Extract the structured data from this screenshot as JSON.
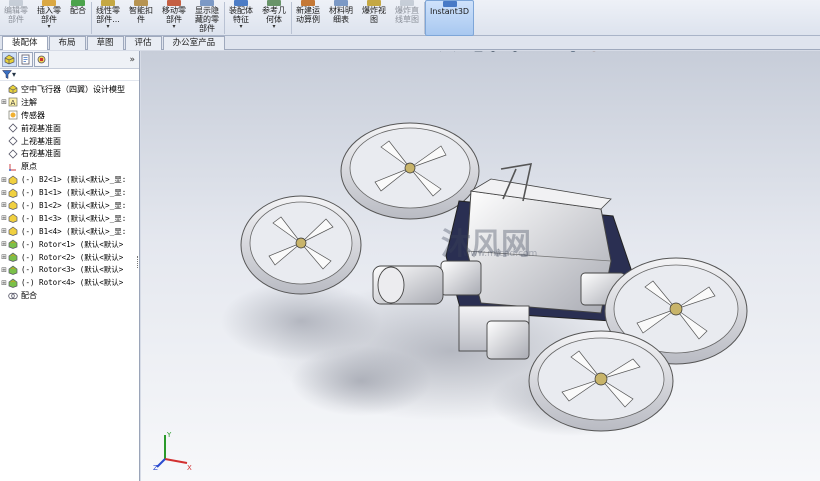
{
  "ribbon": {
    "items": [
      {
        "label": "编辑零\n部件",
        "disabled": true
      },
      {
        "label": "插入零\n部件",
        "arrow": true
      },
      {
        "label": "配合"
      },
      {
        "label": "线性零\n部件...",
        "arrow": true
      },
      {
        "label": "智能扣\n件"
      },
      {
        "label": "移动零\n部件",
        "arrow": true
      },
      {
        "label": "显示隐\n藏的零\n部件"
      },
      {
        "label": "装配体\n特征",
        "arrow": true
      },
      {
        "label": "参考几\n何体",
        "arrow": true
      },
      {
        "label": "新建运\n动算例"
      },
      {
        "label": "材料明\n细表"
      },
      {
        "label": "爆炸视\n图"
      },
      {
        "label": "爆炸直\n线草图",
        "disabled": true
      },
      {
        "label": "Instant3D",
        "active": true
      }
    ]
  },
  "tabs": [
    "装配体",
    "布局",
    "草图",
    "评估",
    "办公室产品"
  ],
  "panel": {
    "collapse_glyph": "»",
    "filter_glyph": "▾",
    "tree": [
      {
        "exp": "",
        "icon": "assembly-icon",
        "label": "空中飞行器（四翼）设计模型",
        "mono": false
      },
      {
        "exp": "⊞",
        "icon": "annotations-icon",
        "label": "注解",
        "mono": false
      },
      {
        "exp": "",
        "icon": "sensor-icon",
        "label": "传感器",
        "mono": false
      },
      {
        "exp": "",
        "icon": "plane-icon",
        "label": "前视基准面",
        "mono": false
      },
      {
        "exp": "",
        "icon": "plane-icon",
        "label": "上视基准面",
        "mono": false
      },
      {
        "exp": "",
        "icon": "plane-icon",
        "label": "右视基准面",
        "mono": false
      },
      {
        "exp": "",
        "icon": "origin-icon",
        "label": "原点",
        "mono": false
      },
      {
        "exp": "⊞",
        "icon": "part-icon",
        "label": "(-) B2<1> (默认<默认>_显:",
        "mono": true
      },
      {
        "exp": "⊞",
        "icon": "part-icon",
        "label": "(-) B1<1> (默认<默认>_显:",
        "mono": true
      },
      {
        "exp": "⊞",
        "icon": "part-icon",
        "label": "(-) B1<2> (默认<默认>_显:",
        "mono": true
      },
      {
        "exp": "⊞",
        "icon": "part-icon",
        "label": "(-) B1<3> (默认<默认>_显:",
        "mono": true
      },
      {
        "exp": "⊞",
        "icon": "part-icon",
        "label": "(-) B1<4> (默认<默认>_显:",
        "mono": true
      },
      {
        "exp": "⊞",
        "icon": "subassembly-icon",
        "label": "(-) Rotor<1> (默认<默认>",
        "mono": true
      },
      {
        "exp": "⊞",
        "icon": "subassembly-icon",
        "label": "(-) Rotor<2> (默认<默认>",
        "mono": true
      },
      {
        "exp": "⊞",
        "icon": "subassembly-icon",
        "label": "(-) Rotor<3> (默认<默认>",
        "mono": true
      },
      {
        "exp": "⊞",
        "icon": "subassembly-icon",
        "label": "(-) Rotor<4> (默认<默认>",
        "mono": true
      },
      {
        "exp": "",
        "icon": "mates-icon",
        "label": "配合",
        "mono": false
      }
    ]
  },
  "watermark": {
    "main": "沐风网",
    "sub": "www.mfcad.com"
  },
  "triad": {
    "x": "X",
    "y": "Y",
    "z": "Z"
  },
  "colors": {
    "accent": "#3a6fc0",
    "model_body": "#e8e8e8",
    "model_dark": "#2a2f52"
  }
}
